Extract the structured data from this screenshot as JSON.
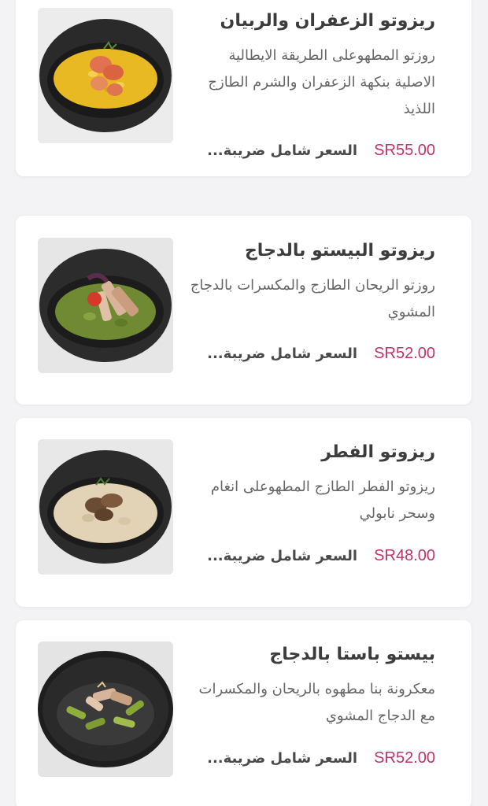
{
  "menu_items": [
    {
      "title": "ريزوتو الزعفران والربيان",
      "description": "روزتو المطهوعلى الطريقة الايطالية الاصلية بنكهة الزعفران والشرم الطازج اللذيذ",
      "price": "SR55.00",
      "tax_note": "السعر شامل ضريبة..."
    },
    {
      "title": "ريزوتو البيستو بالدجاج",
      "description": "روزتو الريحان الطازج والمكسرات بالدجاج المشوي",
      "price": "SR52.00",
      "tax_note": "السعر شامل ضريبة..."
    },
    {
      "title": "ريزوتو الفطر",
      "description": "ريزوتو الفطر الطازج المطهوعلى انغام وسحر نابولي",
      "price": "SR48.00",
      "tax_note": "السعر شامل ضريبة..."
    },
    {
      "title": "بيستو باستا بالدجاج",
      "description": "معكرونة بنا مطهوه بالريحان والمكسرات مع الدجاج المشوي",
      "price": "SR52.00",
      "tax_note": "السعر شامل ضريبة..."
    }
  ],
  "colors": {
    "price": "#c0336b",
    "title": "#3c3c3c",
    "background": "#f3f3f5"
  }
}
